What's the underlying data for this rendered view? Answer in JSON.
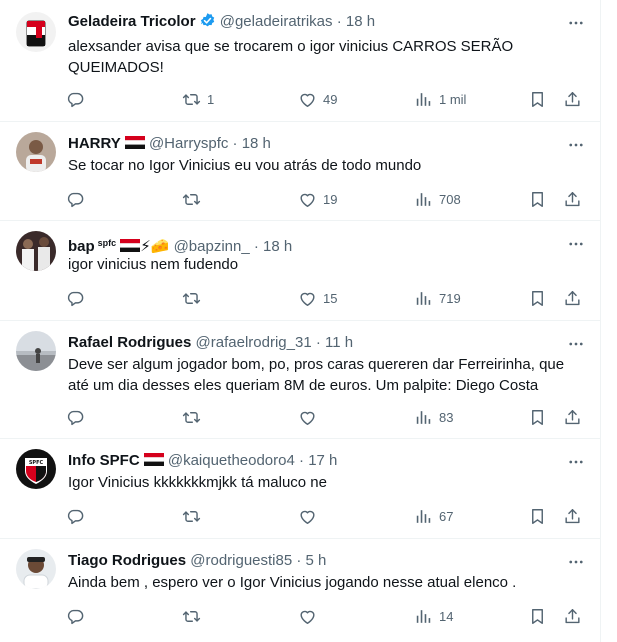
{
  "tweets": [
    {
      "name": "Geladeira Tricolor",
      "handle": "@geladeiratrikas",
      "time": "18 h",
      "text": "alexsander avisa que se trocarem o igor vinicius CARROS SERÃO QUEIMADOS!",
      "replies": "",
      "retweets": "1",
      "likes": "49",
      "views": "1 mil",
      "verified": true
    },
    {
      "name": "HARRY",
      "handle": "@Harryspfc",
      "time": "18 h",
      "text": "Se tocar no Igor Vinicius eu vou atrás de todo mundo",
      "replies": "",
      "retweets": "",
      "likes": "19",
      "views": "708"
    },
    {
      "name": "bap",
      "name_sup": "spfc",
      "name_emoji": "⚡🧀",
      "handle": "@bapzinn_",
      "time": "18 h",
      "text": "igor vinicius nem fudendo",
      "replies": "",
      "retweets": "",
      "likes": "15",
      "views": "719"
    },
    {
      "name": "Rafael Rodrigues",
      "handle": "@rafaelrodrig_31",
      "time": "11 h",
      "text": "Deve ser algum jogador bom, po, pros caras quereren dar Ferreirinha, que até um dia desses eles queriam 8M de euros. Um palpite: Diego Costa",
      "replies": "",
      "retweets": "",
      "likes": "",
      "views": "83"
    },
    {
      "name": "Info SPFC",
      "handle": "@kaiquetheodoro4",
      "time": "17 h",
      "text": "Igor Vinicius kkkkkkkmjkk tá maluco ne",
      "replies": "",
      "retweets": "",
      "likes": "",
      "views": "67"
    },
    {
      "name": "Tiago Rodrigues",
      "handle": "@rodriguesti85",
      "time": "5 h",
      "text": "Ainda bem , espero ver o Igor Vinicius jogando nesse atual elenco .",
      "replies": "",
      "retweets": "",
      "likes": "",
      "views": "14"
    }
  ],
  "separator": "·",
  "icons": {
    "reply": "reply-icon",
    "retweet": "retweet-icon",
    "like": "heart-icon",
    "views": "views-icon",
    "bookmark": "bookmark-icon",
    "share": "share-icon",
    "more": "more-icon",
    "verified": "verified-badge-icon"
  },
  "colors": {
    "text": "#0f1419",
    "secondary": "#536471",
    "divider": "#eff3f4",
    "verified": "#1d9bf0",
    "flag_red": "#d5001c",
    "flag_black": "#111111"
  }
}
